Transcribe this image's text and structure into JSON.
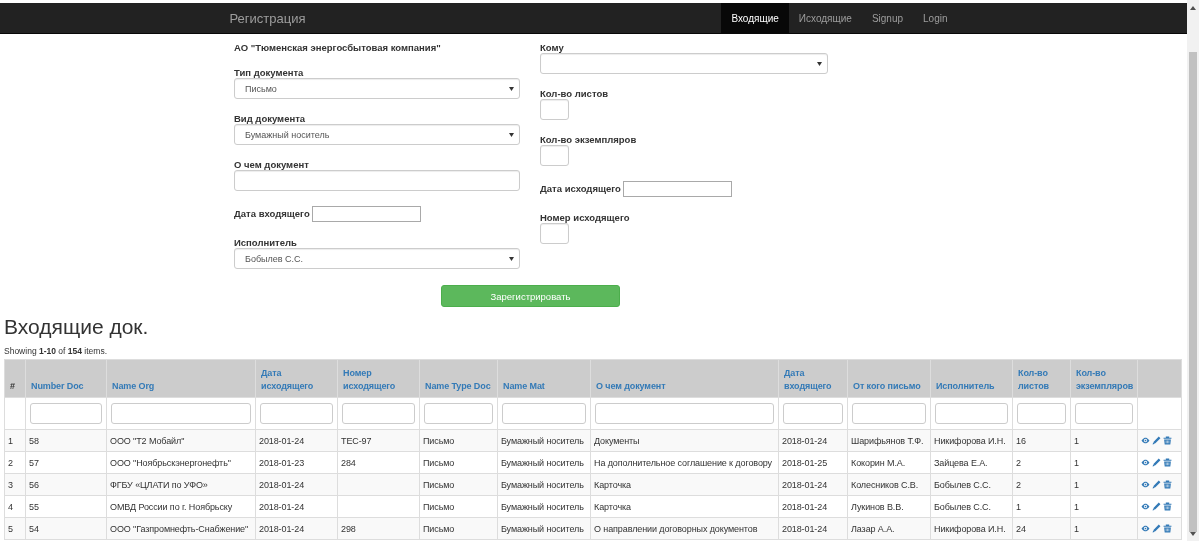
{
  "navbar": {
    "brand": "Регистрация",
    "items": [
      {
        "label": "Входящие",
        "selected": true
      },
      {
        "label": "Исходящие",
        "selected": false
      },
      {
        "label": "Signup",
        "selected": false
      },
      {
        "label": "Login",
        "selected": false
      }
    ]
  },
  "form": {
    "organization": "АО \"Тюменская энергосбытовая компания\"",
    "left_fields": [
      {
        "kind": "select",
        "label": "Тип документа",
        "value": "Письмо"
      },
      {
        "kind": "select",
        "label": "Вид документа",
        "value": "Бумажный носитель"
      },
      {
        "kind": "text",
        "label": "О чем документ"
      },
      {
        "kind": "inline",
        "label": "Дата входящего"
      },
      {
        "kind": "select",
        "label": "Исполнитель",
        "value": "Бобылев С.С."
      }
    ],
    "right_fields": [
      {
        "kind": "select",
        "label": "Кому"
      },
      {
        "kind": "small",
        "label": "Кол-во листов"
      },
      {
        "kind": "small",
        "label": "Кол-во экземпляров"
      },
      {
        "kind": "inline",
        "label": "Дата исходящего"
      },
      {
        "kind": "small",
        "label": "Номер исходящего"
      }
    ],
    "submit_button": "Зарегистрировать"
  },
  "heading": "Входящие док.",
  "summary": "Showing **1-10** of **154** items.",
  "table": {
    "columns": [
      {
        "label": "#",
        "filter": false
      },
      {
        "label": "Number Doc",
        "filter": true
      },
      {
        "label": "Name Org",
        "filter": true
      },
      {
        "label": "Дата исходящего",
        "filter": true
      },
      {
        "label": "Номер исходящего",
        "filter": true
      },
      {
        "label": "Name Type Doc",
        "filter": true
      },
      {
        "label": "Name Mat",
        "filter": true
      },
      {
        "label": "О чем документ",
        "filter": true
      },
      {
        "label": "Дата входящего",
        "filter": true
      },
      {
        "label": "От кого письмо",
        "filter": true
      },
      {
        "label": "Исполнитель",
        "filter": true
      },
      {
        "label": "Кол-во листов",
        "filter": true
      },
      {
        "label": "Кол-во экземпляров",
        "filter": true
      }
    ],
    "rows": [
      [
        "1",
        "58",
        "ООО \"Т2 Мобайл\"",
        "2018-01-24",
        "TEC-97",
        "Письмо",
        "Бумажный носитель",
        "Документы",
        "2018-01-24",
        "Шарифьянов Т.Ф.",
        "Никифорова И.Н.",
        "16",
        "1"
      ],
      [
        "2",
        "57",
        "ООО \"Ноябрьскэнергонефть\"",
        "2018-01-23",
        "284",
        "Письмо",
        "Бумажный носитель",
        "На дополнительное соглашение к договору",
        "2018-01-25",
        "Кокорин М.А.",
        "Зайцева Е.А.",
        "2",
        "1"
      ],
      [
        "3",
        "56",
        "ФГБУ «ЦЛАТИ по УФО»",
        "2018-01-24",
        "",
        "Письмо",
        "Бумажный носитель",
        "Карточка",
        "2018-01-24",
        "Колесников С.В.",
        "Бобылев С.С.",
        "2",
        "1"
      ],
      [
        "4",
        "55",
        "ОМВД России по г. Ноябрьску",
        "2018-01-24",
        "",
        "Письмо",
        "Бумажный носитель",
        "Карточка",
        "2018-01-24",
        "Лукинов В.В.",
        "Бобылев С.С.",
        "1",
        "1"
      ],
      [
        "5",
        "54",
        "ООО \"Газпромнефть-Снабжение\"",
        "2018-01-24",
        "298",
        "Письмо",
        "Бумажный носитель",
        "О направлении договорных документов",
        "2018-01-24",
        "Лазар А.А.",
        "Никифорова И.Н.",
        "24",
        "1"
      ]
    ]
  }
}
